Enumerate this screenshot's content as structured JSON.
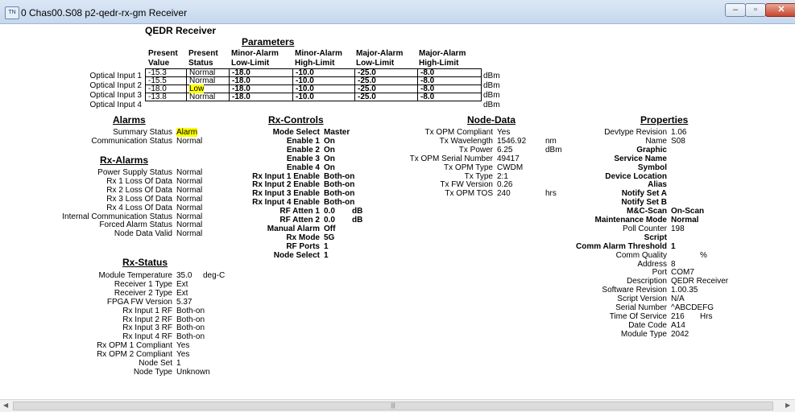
{
  "window": {
    "title": "0 Chas00.S08 p2-qedr-rx-gm Receiver",
    "icon_text": "TN",
    "minimize": "–",
    "maximize": "▫",
    "close": "✕"
  },
  "page": {
    "title": "QEDR Receiver"
  },
  "parameters": {
    "heading": "Parameters",
    "headers": [
      [
        "Present",
        "Value"
      ],
      [
        "Present",
        "Status"
      ],
      [
        "Minor-Alarm",
        "Low-Limit"
      ],
      [
        "Minor-Alarm",
        "High-Limit"
      ],
      [
        "Major-Alarm",
        "Low-Limit"
      ],
      [
        "Major-Alarm",
        "High-Limit"
      ]
    ],
    "unit": "dBm",
    "rows": [
      {
        "label": "Optical Input 1",
        "value": "-15.3",
        "status": "Normal",
        "minor_low": "-18.0",
        "minor_high": "-10.0",
        "major_low": "-25.0",
        "major_high": "-8.0"
      },
      {
        "label": "Optical Input 2",
        "value": "-15.5",
        "status": "Normal",
        "minor_low": "-18.0",
        "minor_high": "-10.0",
        "major_low": "-25.0",
        "major_high": "-8.0"
      },
      {
        "label": "Optical Input 3",
        "value": "-18.0",
        "status": "Low",
        "minor_low": "-18.0",
        "minor_high": "-10.0",
        "major_low": "-25.0",
        "major_high": "-8.0"
      },
      {
        "label": "Optical Input 4",
        "value": "-13.8",
        "status": "Normal",
        "minor_low": "-18.0",
        "minor_high": "-10.0",
        "major_low": "-25.0",
        "major_high": "-8.0"
      }
    ]
  },
  "alarms": {
    "heading": "Alarms",
    "rows": [
      {
        "label": "Summary Status",
        "value": "Alarm"
      },
      {
        "label": "Communication Status",
        "value": "Normal"
      }
    ]
  },
  "rx_alarms": {
    "heading": "Rx-Alarms",
    "rows": [
      {
        "label": "Power Supply Status",
        "value": "Normal"
      },
      {
        "label": "Rx 1 Loss Of Data",
        "value": "Normal"
      },
      {
        "label": "Rx 2 Loss Of Data",
        "value": "Normal"
      },
      {
        "label": "Rx 3 Loss Of Data",
        "value": "Normal"
      },
      {
        "label": "Rx 4 Loss Of Data",
        "value": "Normal"
      },
      {
        "label": "Internal Communication Status",
        "value": "Normal"
      },
      {
        "label": "Forced Alarm Status",
        "value": "Normal"
      },
      {
        "label": "Node Data Valid",
        "value": "Normal"
      }
    ]
  },
  "rx_status": {
    "heading": "Rx-Status",
    "rows": [
      {
        "label": "Module Temperature",
        "value": "35.0",
        "unit": "deg-C"
      },
      {
        "label": "Receiver 1 Type",
        "value": "Ext"
      },
      {
        "label": "Receiver 2 Type",
        "value": "Ext"
      },
      {
        "label": "FPGA FW Version",
        "value": "5.37"
      },
      {
        "label": "Rx Input 1 RF",
        "value": "Both-on"
      },
      {
        "label": "Rx Input 2 RF",
        "value": "Both-on"
      },
      {
        "label": "Rx Input 3 RF",
        "value": "Both-on"
      },
      {
        "label": "Rx Input 4 RF",
        "value": "Both-on"
      },
      {
        "label": "Rx OPM 1 Compliant",
        "value": "Yes"
      },
      {
        "label": "Rx OPM 2 Compliant",
        "value": "Yes"
      },
      {
        "label": "Node Set",
        "value": "1"
      },
      {
        "label": "Node Type",
        "value": "Unknown"
      }
    ]
  },
  "rx_controls": {
    "heading": "Rx-Controls",
    "rows": [
      {
        "label": "Mode Select",
        "value": "Master"
      },
      {
        "label": "Enable 1",
        "value": "On"
      },
      {
        "label": "Enable 2",
        "value": "On"
      },
      {
        "label": "Enable 3",
        "value": "On"
      },
      {
        "label": "Enable 4",
        "value": "On"
      },
      {
        "label": "Rx Input 1 Enable",
        "value": "Both-on"
      },
      {
        "label": "Rx Input 2 Enable",
        "value": "Both-on"
      },
      {
        "label": "Rx Input 3 Enable",
        "value": "Both-on"
      },
      {
        "label": "Rx Input 4 Enable",
        "value": "Both-on"
      },
      {
        "label": "RF Atten 1",
        "value": "0.0",
        "unit": "dB"
      },
      {
        "label": "RF Atten 2",
        "value": "0.0",
        "unit": "dB"
      },
      {
        "label": "Manual Alarm",
        "value": "Off"
      },
      {
        "label": "Rx Mode",
        "value": "5G"
      },
      {
        "label": "RF Ports",
        "value": "1"
      },
      {
        "label": "Node Select",
        "value": "1"
      }
    ]
  },
  "node_data": {
    "heading": "Node-Data",
    "rows": [
      {
        "label": "Tx OPM Compliant",
        "value": "Yes"
      },
      {
        "label": "Tx Wavelength",
        "value": "1546.92",
        "unit": "nm"
      },
      {
        "label": "Tx Power",
        "value": "6.25",
        "unit": "dBm"
      },
      {
        "label": "Tx OPM Serial Number",
        "value": "49417"
      },
      {
        "label": "Tx OPM Type",
        "value": "CWDM"
      },
      {
        "label": "Tx Type",
        "value": "2:1"
      },
      {
        "label": "Tx FW Version",
        "value": "0.26"
      },
      {
        "label": "Tx OPM TOS",
        "value": "240",
        "unit": "hrs"
      }
    ]
  },
  "properties": {
    "heading": "Properties",
    "rows": [
      {
        "label": "Devtype Revision",
        "value": "1.06"
      },
      {
        "label": "Name",
        "value": "S08"
      },
      {
        "label": "Graphic",
        "value": ""
      },
      {
        "label": "Service Name",
        "value": ""
      },
      {
        "label": "Symbol",
        "value": ""
      },
      {
        "label": "Device Location",
        "value": ""
      },
      {
        "label": "Alias",
        "value": ""
      },
      {
        "label": "Notify Set A",
        "value": ""
      },
      {
        "label": "Notify Set B",
        "value": ""
      },
      {
        "label": "M&C-Scan",
        "value": "On-Scan"
      },
      {
        "label": "Maintenance Mode",
        "value": "Normal"
      },
      {
        "label": "Poll Counter",
        "value": "198"
      },
      {
        "label": "Script",
        "value": ""
      },
      {
        "label": "Comm Alarm Threshold",
        "value": "1"
      },
      {
        "label": "Comm Quality",
        "value": "",
        "unit": "%"
      },
      {
        "label": "Address",
        "value": "8"
      },
      {
        "label": "Port",
        "value": "COM7"
      },
      {
        "label": "Description",
        "value": "QEDR Receiver"
      },
      {
        "label": "Software Revision",
        "value": "1.00.35"
      },
      {
        "label": "Script Version",
        "value": "N/A"
      },
      {
        "label": "Serial Number",
        "value": "^ABCDEFG"
      },
      {
        "label": "Time Of Service",
        "value": "216",
        "unit": "Hrs"
      },
      {
        "label": "Date Code",
        "value": " A14"
      },
      {
        "label": "Module Type",
        "value": "2042"
      }
    ]
  },
  "scrollbar": {
    "left_arrow": "◀",
    "right_arrow": "▶",
    "grip": "|||"
  }
}
